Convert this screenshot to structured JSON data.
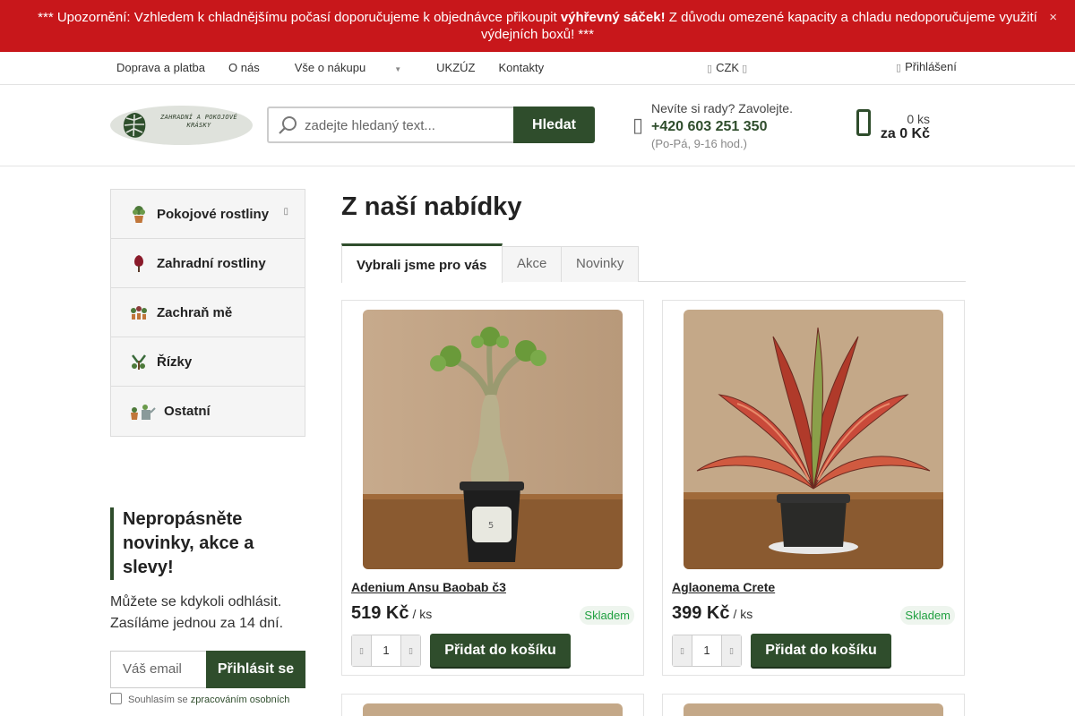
{
  "alert": {
    "text_before": "*** Upozornění: Vzhledem k chladnějšímu počasí doporučujeme k objednávce přikoupit ",
    "text_bold": "výhřevný sáček!",
    "text_after": " Z důvodu omezené kapacity a chladu nedoporučujeme využití výdejních boxů! ***",
    "close_icon": "×",
    "background": "#c8171b"
  },
  "topnav": {
    "items": [
      "Doprava a platba",
      "O nás",
      "Vše o nákupu",
      "UKZÚZ",
      "Kontakty"
    ],
    "currency": "CZK",
    "login": "Přihlášení"
  },
  "header": {
    "logo_text": "ZAHRADNÍ A POKOJOVÉ KRÁSKY",
    "search_placeholder": "zadejte hledaný text...",
    "search_button": "Hledat",
    "contact_title": "Nevíte si rady? Zavolejte.",
    "contact_phone": "+420 603 251 350",
    "contact_hours": "(Po-Pá, 9-16 hod.)",
    "cart_qty": "0 ks",
    "cart_total": "za 0 Kč"
  },
  "sidebar": {
    "items": [
      {
        "label": "Pokojové rostliny",
        "icon": "potted-plant-icon"
      },
      {
        "label": "Zahradní rostliny",
        "icon": "tree-icon"
      },
      {
        "label": "Zachraň mě",
        "icon": "plants-rescue-icon"
      },
      {
        "label": "Řízky",
        "icon": "cuttings-icon"
      },
      {
        "label": "Ostatní",
        "icon": "watering-can-icon"
      }
    ]
  },
  "newsletter": {
    "title": "Nepropásněte novinky, akce a slevy!",
    "desc": "Můžete se kdykoli odhlásit. Zasíláme jednou za 14 dní.",
    "email_placeholder": "Váš email",
    "submit": "Přihlásit se",
    "consent_prefix": "Souhlasím se ",
    "consent_link": "zpracováním osobních"
  },
  "main": {
    "title": "Z naší nabídky",
    "tabs": [
      "Vybrali jsme pro vás",
      "Akce",
      "Novinky"
    ],
    "products": [
      {
        "name": "Adenium Ansu Baobab č3",
        "price": "519 Kč",
        "unit": "/ ks",
        "stock": "Skladem",
        "qty": "1",
        "add": "Přidat do košíku"
      },
      {
        "name": "Aglaonema Crete",
        "price": "399 Kč",
        "unit": "/ ks",
        "stock": "Skladem",
        "qty": "1",
        "add": "Přidat do košíku"
      }
    ]
  },
  "colors": {
    "accent": "#2f4d2c",
    "stock": "#20a040"
  }
}
